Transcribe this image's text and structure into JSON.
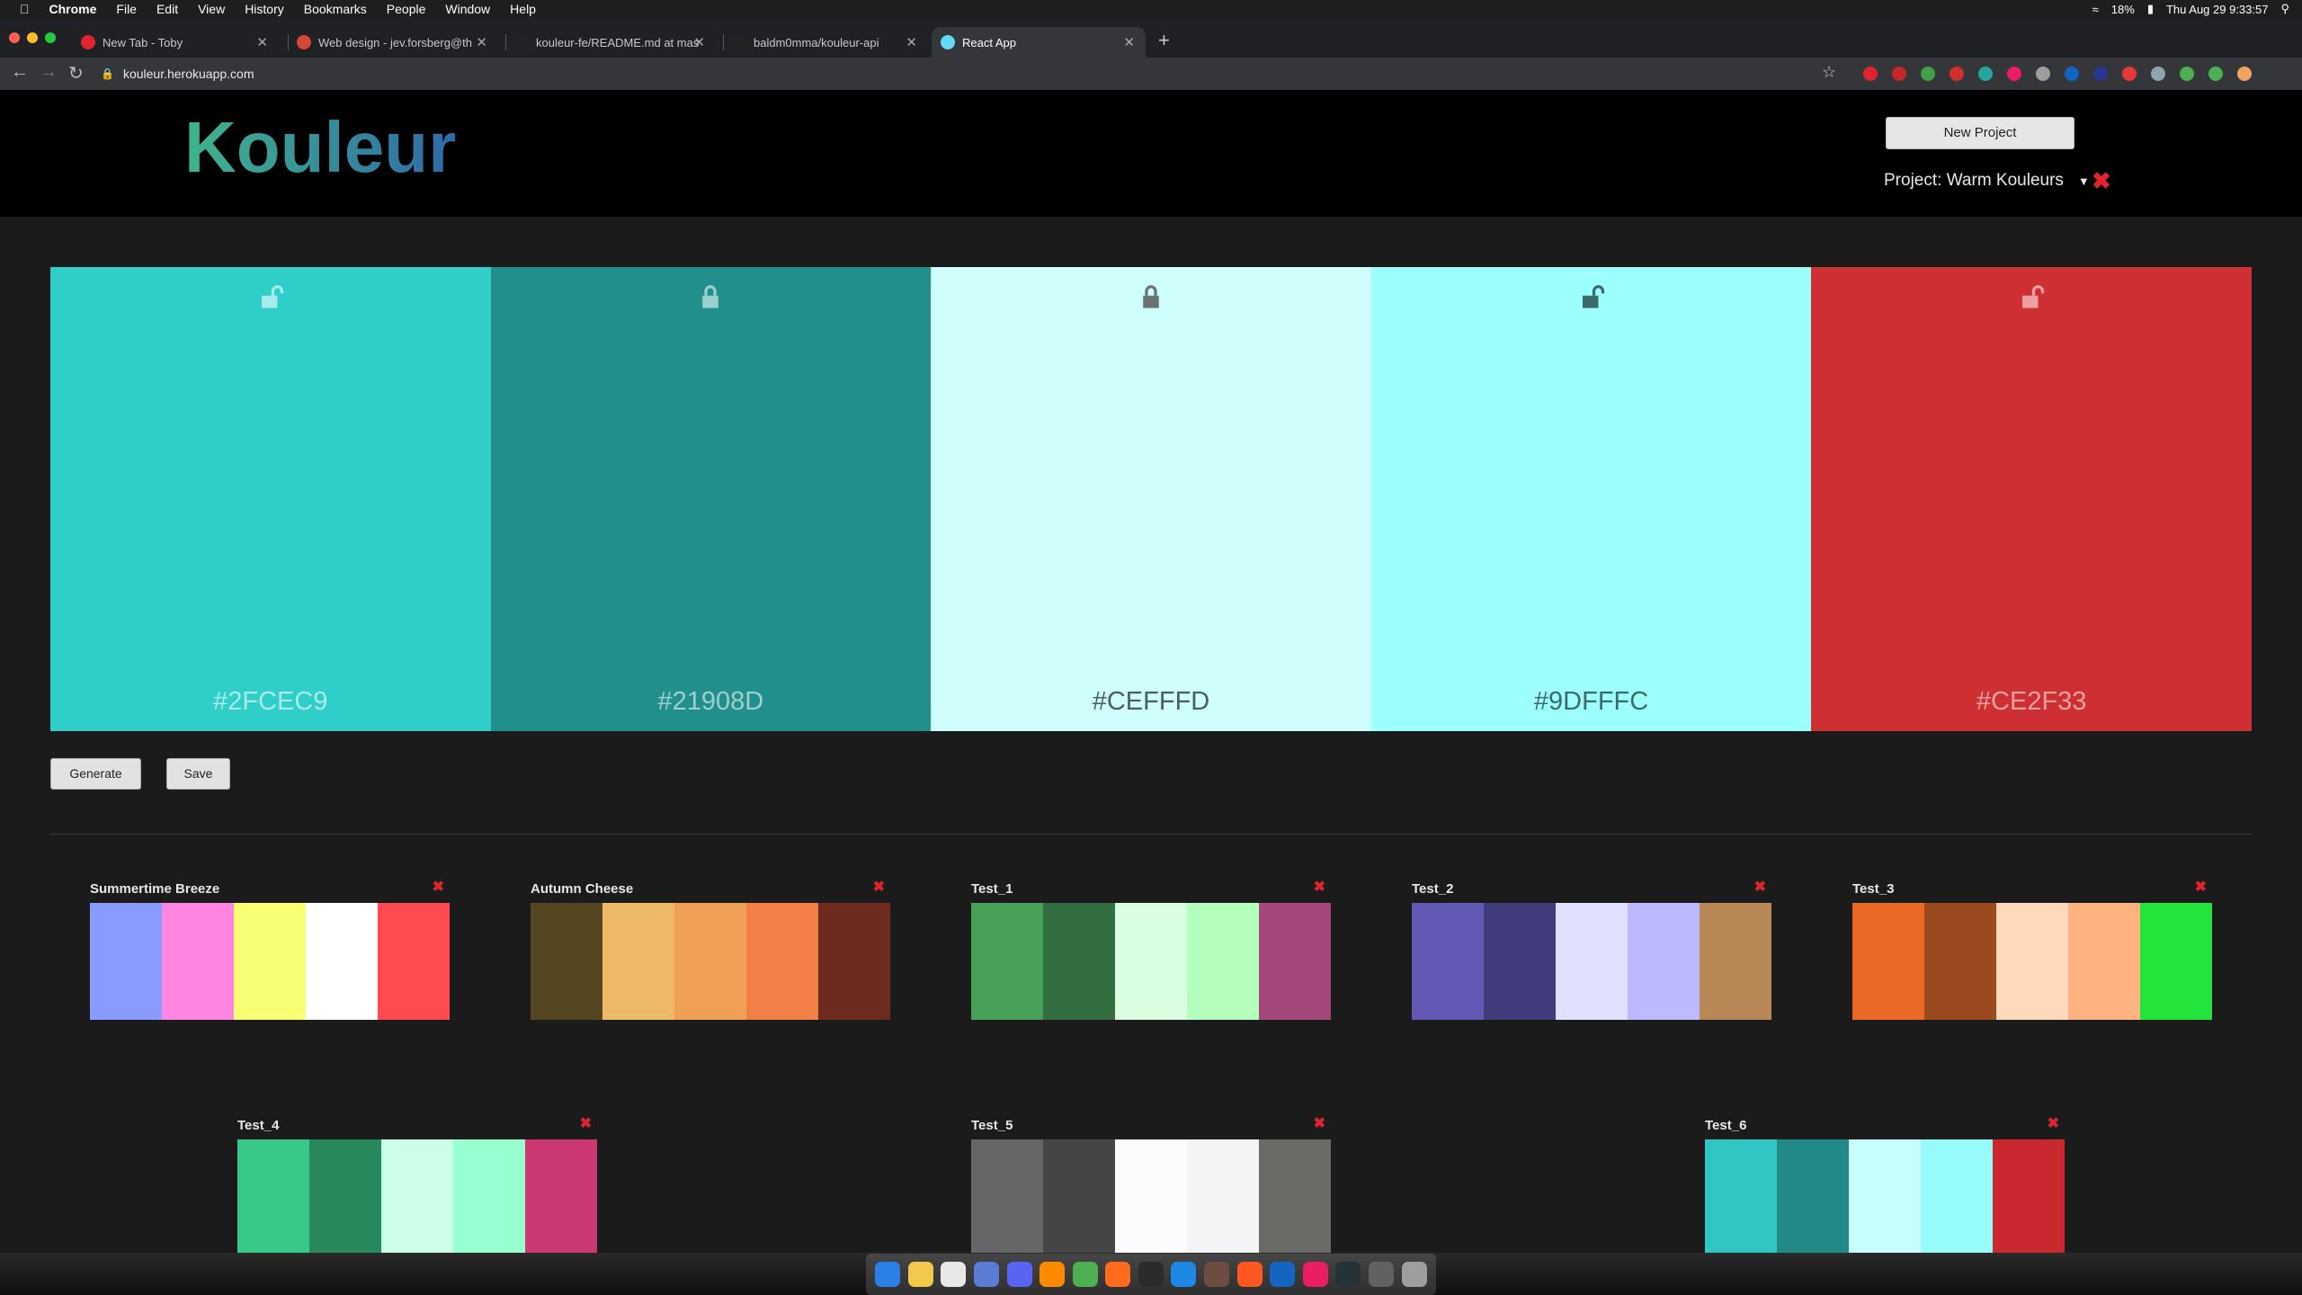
{
  "menubar": {
    "app": "Chrome",
    "items": [
      "File",
      "Edit",
      "View",
      "History",
      "Bookmarks",
      "People",
      "Window",
      "Help"
    ],
    "battery": "18%",
    "clock": "Thu Aug 29  9:33:57"
  },
  "tabs": [
    {
      "title": "New Tab - Toby",
      "favicon_color": "#e0242e"
    },
    {
      "title": "Web design - jev.forsberg@th",
      "favicon_color": "#d44638"
    },
    {
      "title": "kouleur-fe/README.md at mas",
      "favicon_color": "#222222"
    },
    {
      "title": "baldm0mma/kouleur-api",
      "favicon_color": "#222222"
    },
    {
      "title": "React App",
      "favicon_color": "#61dafb"
    }
  ],
  "address": {
    "url": "kouleur.herokuapp.com"
  },
  "header": {
    "logo": "Kouleur",
    "new_project": "New Project",
    "project_label": "Project: Warm Kouleurs"
  },
  "palette": [
    {
      "hex": "#2FCEC9",
      "locked": false,
      "text_color": "#a9eae8",
      "lock_color": "#a6ecea"
    },
    {
      "hex": "#21908D",
      "locked": true,
      "text_color": "#9ccfcd",
      "lock_color": "#9ccfcd"
    },
    {
      "hex": "#CEFFFD",
      "locked": true,
      "text_color": "#4a5e5e",
      "lock_color": "#6a7272"
    },
    {
      "hex": "#9DFFFC",
      "locked": false,
      "text_color": "#3b6c6a",
      "lock_color": "#3b6c6a"
    },
    {
      "hex": "#CE2F33",
      "locked": false,
      "text_color": "#eea0a1",
      "lock_color": "#eea0a1"
    }
  ],
  "actions": {
    "generate": "Generate",
    "save": "Save"
  },
  "saved": [
    {
      "name": "Summertime Breeze",
      "colors": [
        "#8a9bff",
        "#ff85e0",
        "#f7ff73",
        "#ffffff",
        "#ff4a52"
      ]
    },
    {
      "name": "Autumn Cheese",
      "colors": [
        "#554622",
        "#eeba6a",
        "#f0a055",
        "#f27f48",
        "#6d2a1f"
      ]
    },
    {
      "name": "Test_1",
      "colors": [
        "#47a158",
        "#326e3f",
        "#daffe0",
        "#b4ffbc",
        "#a4487c"
      ]
    },
    {
      "name": "Test_2",
      "colors": [
        "#6259b4",
        "#403b7a",
        "#e2e0ff",
        "#bdb9ff",
        "#b78756"
      ]
    },
    {
      "name": "Test_3",
      "colors": [
        "#ea6a25",
        "#9a4a1e",
        "#ffd9bc",
        "#ffb380",
        "#24e43c"
      ]
    },
    {
      "name": "Test_4",
      "colors": [
        "#38c887",
        "#27885c",
        "#ccffe8",
        "#98ffd0",
        "#cc3871"
      ]
    },
    {
      "name": "Test_5",
      "colors": [
        "#666669",
        "#454546",
        "#fbfbfd",
        "#f4f4f7",
        "#6a6a66"
      ]
    },
    {
      "name": "Test_6",
      "colors": [
        "#2fc6c4",
        "#218a87",
        "#c8fffd",
        "#96fbf9",
        "#c9282f"
      ]
    }
  ],
  "dock": [
    "#2a80e8",
    "#f2c94c",
    "#e8e8e8",
    "#5b7bd5",
    "#5865f2",
    "#ff8a00",
    "#4caf50",
    "#ff6b1a",
    "#2b2b2b",
    "#1e88e5",
    "#6d4c41",
    "#ff5722",
    "#1565c0",
    "#e91e63",
    "#263238",
    "#616161",
    "#9e9e9e"
  ]
}
